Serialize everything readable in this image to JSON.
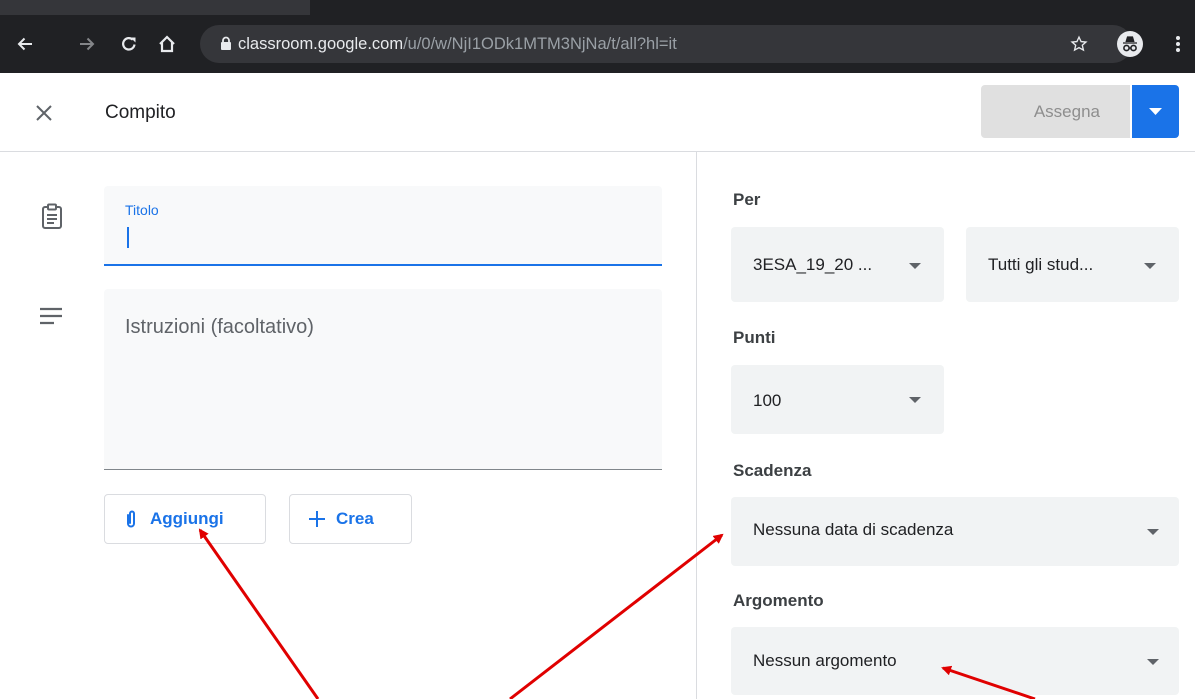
{
  "browser": {
    "url_host": "classroom.google.com",
    "url_path": "/u/0/w/NjI1ODk1MTM3NjNa/t/all?hl=it"
  },
  "header": {
    "title": "Compito",
    "assign_label": "Assegna"
  },
  "form": {
    "title_label": "Titolo",
    "title_value": "",
    "instructions_placeholder": "Istruzioni (facoltativo)",
    "add_label": "Aggiungi",
    "create_label": "Crea"
  },
  "settings": {
    "for_label": "Per",
    "class_value": "3ESA_19_20 ...",
    "students_value": "Tutti gli stud...",
    "points_label": "Punti",
    "points_value": "100",
    "due_label": "Scadenza",
    "due_value": "Nessuna data di scadenza",
    "topic_label": "Argomento",
    "topic_value": "Nessun argomento"
  },
  "colors": {
    "accent": "#1a73e8",
    "annotation": "#e00000"
  }
}
